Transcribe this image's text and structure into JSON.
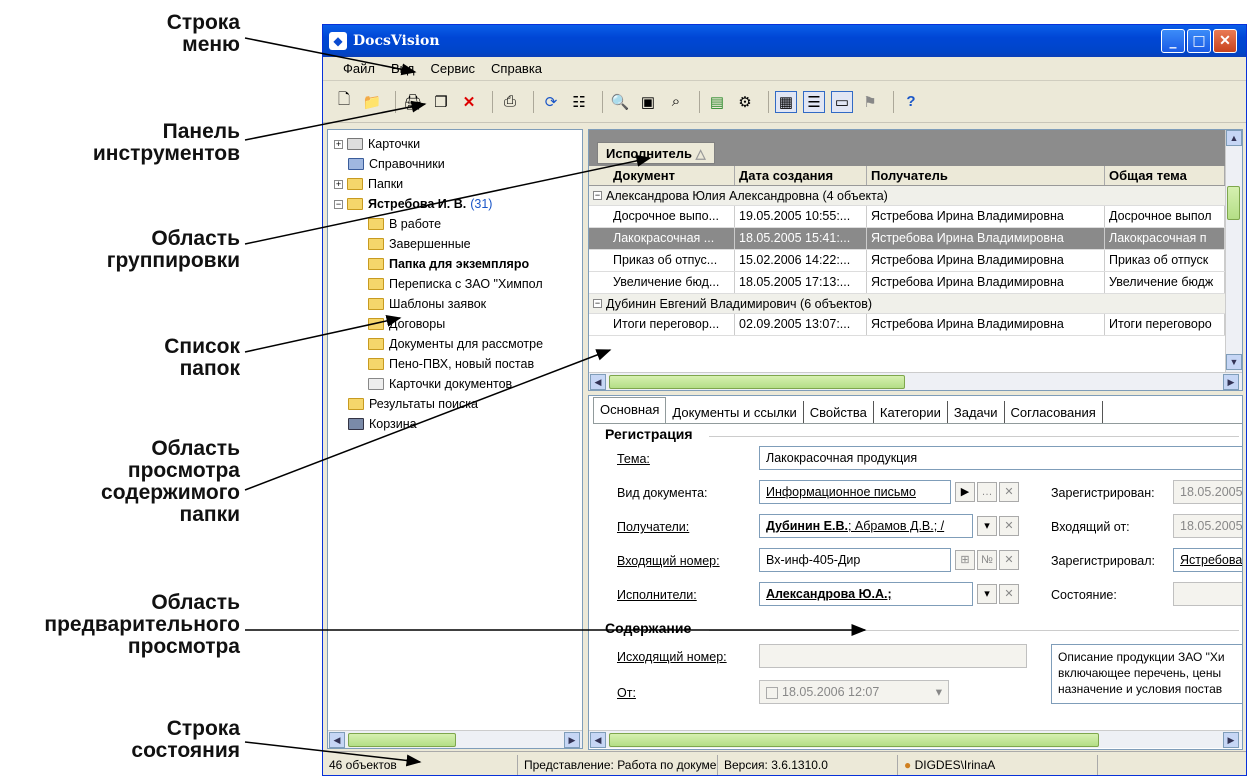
{
  "callouts": {
    "menu_line1": "Строка",
    "menu_line2": "меню",
    "toolbar_line1": "Панель",
    "toolbar_line2": "инструментов",
    "group_line1": "Область",
    "group_line2": "группировки",
    "folders_line1": "Список",
    "folders_line2": "папок",
    "content_line1": "Область",
    "content_line2": "просмотра",
    "content_line3": "содержимого",
    "content_line4": "папки",
    "preview_line1": "Область",
    "preview_line2": "предварительного",
    "preview_line3": "просмотра",
    "status_line1": "Строка",
    "status_line2": "состояния"
  },
  "window": {
    "title": "DocsVision"
  },
  "menu": {
    "file": "Файл",
    "view": "Вид",
    "service": "Сервис",
    "help": "Справка"
  },
  "tree": {
    "cards": "Карточки",
    "directories": "Справочники",
    "folders": "Папки",
    "user": "Ястребова И. В.",
    "user_count": "(31)",
    "in_work": "В работе",
    "finished": "Завершенные",
    "copies": "Папка для экземпляро",
    "correspondence": "Переписка с ЗАО \"Химпол",
    "templates": "Шаблоны заявок",
    "contracts": "Договоры",
    "review": "Документы для рассмотре",
    "foam": "Пено-ПВХ, новый постав",
    "doc_cards": "Карточки документов",
    "search": "Результаты поиска",
    "trash": "Корзина"
  },
  "grid": {
    "group_by": "Исполнитель",
    "headers": [
      "Документ",
      "Дата создания",
      "Получатель",
      "Общая тема"
    ],
    "group1": "Александрова Юлия Александровна (4 объекта)",
    "group2": "Дубинин Евгений Владимирович (6 объектов)",
    "rows": [
      [
        "Досрочное выпо...",
        "19.05.2005 10:55:...",
        "Ястребова Ирина Владимировна",
        "Досрочное выпол"
      ],
      [
        "Лакокрасочная ...",
        "18.05.2005 15:41:...",
        "Ястребова Ирина Владимировна",
        "Лакокрасочная п"
      ],
      [
        "Приказ об отпус...",
        "15.02.2006 14:22:...",
        "Ястребова Ирина Владимировна",
        "Приказ об отпуск"
      ],
      [
        "Увеличение бюд...",
        "18.05.2005 17:13:...",
        "Ястребова Ирина Владимировна",
        "Увеличение бюдж"
      ],
      [
        "Итоги переговор...",
        "02.09.2005 13:07:...",
        "Ястребова Ирина Владимировна",
        "Итоги переговоро"
      ]
    ]
  },
  "preview": {
    "tabs": [
      "Основная",
      "Документы и ссылки",
      "Свойства",
      "Категории",
      "Задачи",
      "Согласования"
    ],
    "section_reg": "Регистрация",
    "section_content": "Содержание",
    "subject_label": "Тема:",
    "subject_value": "Лакокрасочная продукция",
    "doctype_label": "Вид документа:",
    "doctype_value": "Информационное письмо",
    "registered_label": "Зарегистрирован:",
    "registered_value": "18.05.2005",
    "recipients_label": "Получатели:",
    "recipients_bold": "Дубинин Е.В.",
    "recipients_rest": "; Абрамов Д.В.; /",
    "incoming_from_label": "Входящий от:",
    "incoming_from_value": "18.05.2005",
    "incoming_no_label": "Входящий номер:",
    "incoming_no_value": "Вх-инф-405-Дир",
    "no_sign": "№",
    "registered_by_label": "Зарегистрировал:",
    "registered_by_value": "Ястребова",
    "executors_label": "Исполнители:",
    "executors_value": "Александрова Ю.А.;",
    "state_label": "Состояние:",
    "outgoing_label": "Исходящий номер:",
    "outgoing_value": "",
    "from_label": "От:",
    "from_value": "18.05.2006 12:07",
    "description": "Описание продукции ЗАО \"Хи включающее перечень, цены назначение и условия постав"
  },
  "status": {
    "count": "46 объектов",
    "view": "Представление: Работа по документ",
    "version": "Версия: 3.6.1310.0",
    "user": "DIGDES\\IrinaA"
  }
}
